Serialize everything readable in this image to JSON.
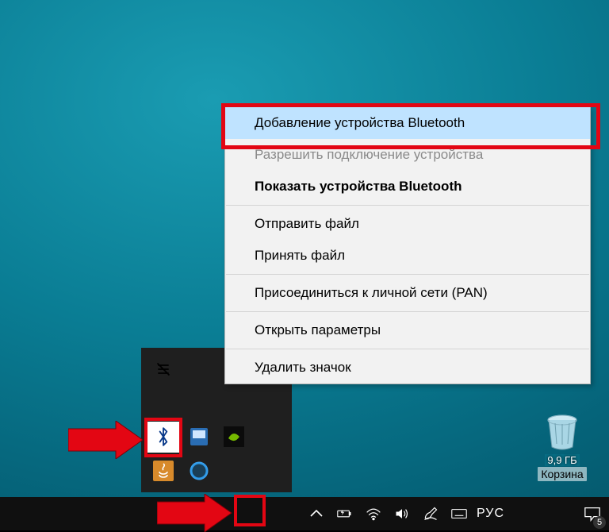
{
  "contextMenu": {
    "items": [
      {
        "label": "Добавление устройства Bluetooth",
        "state": "hover"
      },
      {
        "label": "Разрешить подключение устройства",
        "state": "disabled"
      },
      {
        "label": "Показать устройства Bluetooth",
        "state": "bold"
      }
    ],
    "items2": [
      {
        "label": "Отправить файл"
      },
      {
        "label": "Принять файл"
      }
    ],
    "items3": [
      {
        "label": "Присоединиться к личной сети (PAN)"
      }
    ],
    "items4": [
      {
        "label": "Открыть параметры"
      }
    ],
    "items5": [
      {
        "label": "Удалить значок"
      }
    ]
  },
  "recycleBin": {
    "size": "9,9 ГБ",
    "label": "Корзина"
  },
  "taskbar": {
    "language": "РУС",
    "notifications": "5"
  },
  "iconNames": {
    "bluetooth": "bluetooth-icon",
    "chevUp": "chevron-up-icon",
    "battery": "battery-charging-icon",
    "wifi": "wifi-icon",
    "volume": "volume-icon",
    "pen": "pen-input-icon",
    "keyboard": "touch-keyboard-icon",
    "actionCenter": "action-center-icon"
  }
}
